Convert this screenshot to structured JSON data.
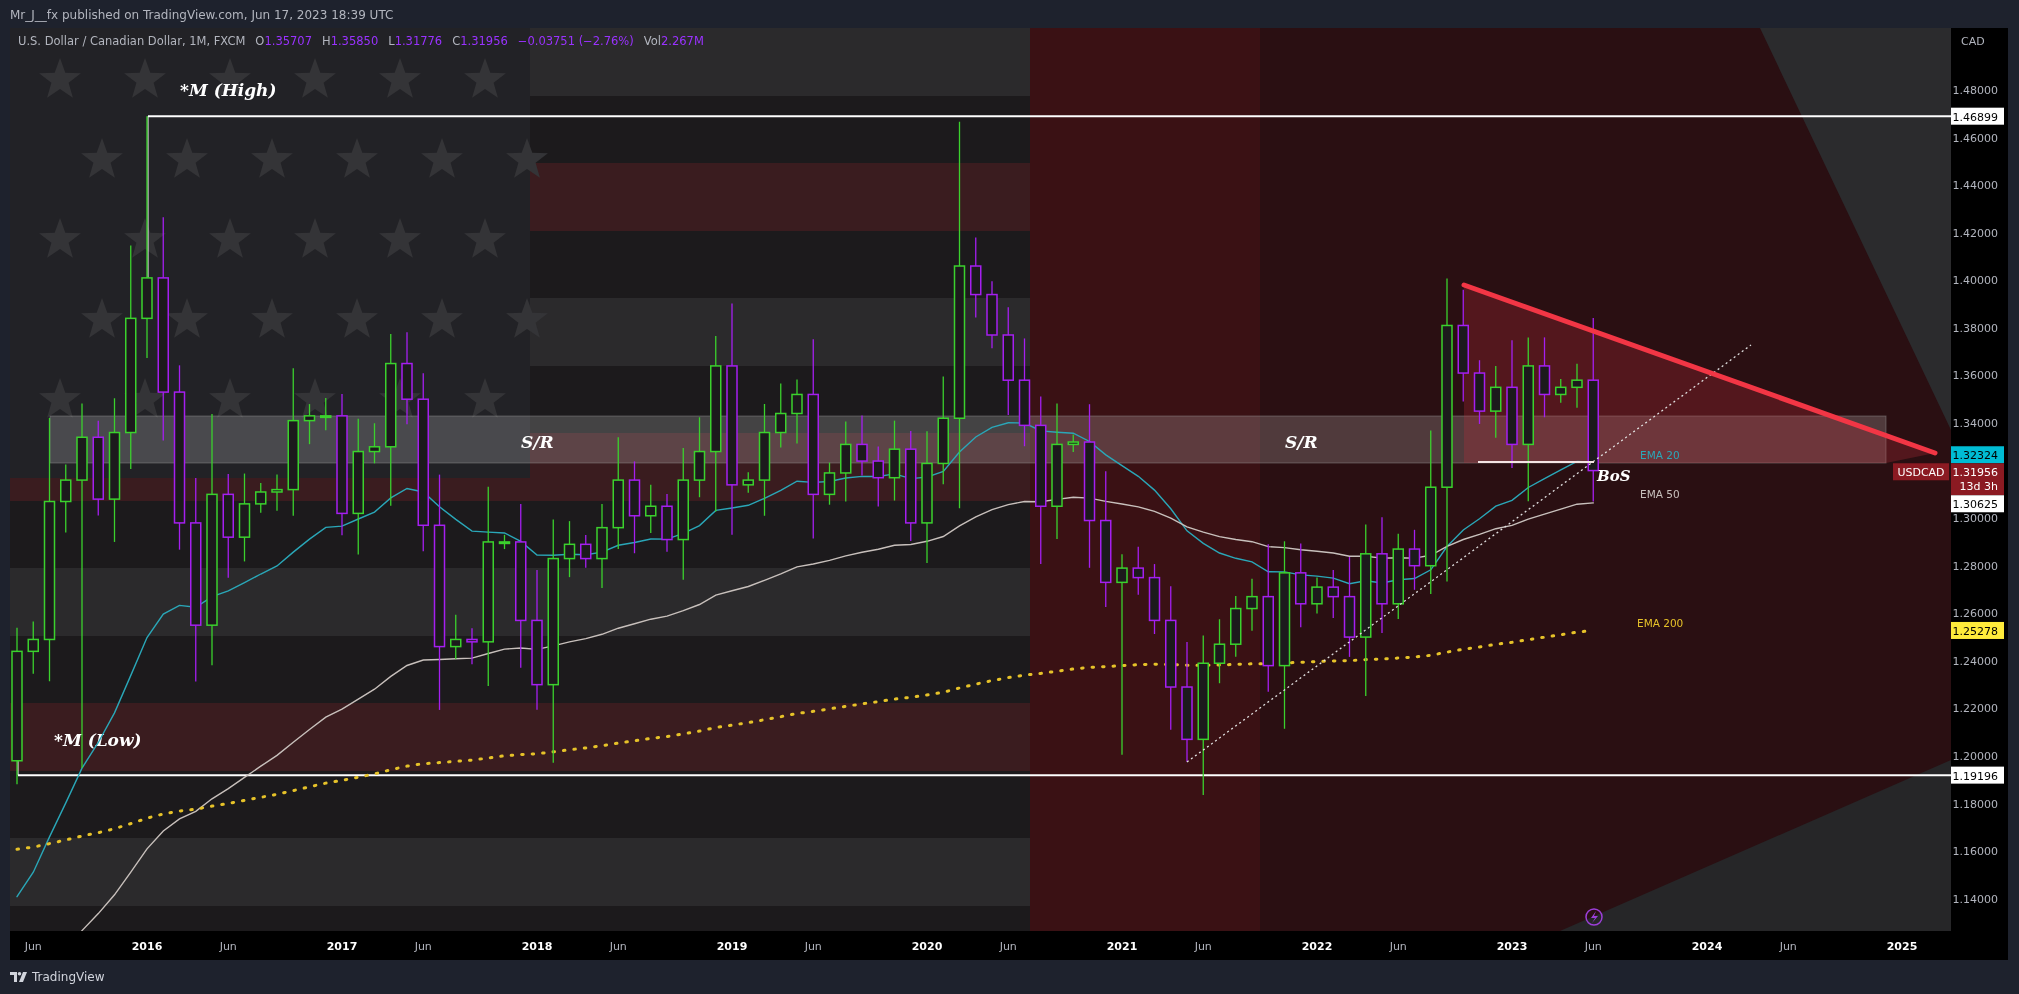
{
  "publisher_line": "Mr_J__fx published on TradingView.com, Jun 17, 2023 18:39 UTC",
  "legend": {
    "symbol": "U.S. Dollar / Canadian Dollar, 1M, FXCM",
    "values": [
      {
        "label": "O",
        "value": "1.35707"
      },
      {
        "label": "H",
        "value": "1.35850"
      },
      {
        "label": "L",
        "value": "1.31776"
      },
      {
        "label": "C",
        "value": "1.31956"
      }
    ],
    "change": "−0.03751 (−2.76%)",
    "volume": {
      "label": "Vol",
      "value": "2.267M"
    }
  },
  "annotations": {
    "high_label": "*M (High)",
    "low_label": "*M (Low)",
    "zone_labels": [
      "S/R",
      "S/R"
    ],
    "bos_label": "BoS"
  },
  "indicators": [
    {
      "name": "EMA 20",
      "color": "#2aa7b8"
    },
    {
      "name": "EMA 50",
      "color": "#c8c0bc"
    },
    {
      "name": "EMA 200",
      "color": "#e6c229"
    }
  ],
  "price_axis": {
    "currency": "CAD",
    "ticks": [
      "1.48000",
      "1.46000",
      "1.44000",
      "1.42000",
      "1.40000",
      "1.38000",
      "1.36000",
      "1.34000",
      "1.30000",
      "1.28000",
      "1.26000",
      "1.24000",
      "1.22000",
      "1.20000",
      "1.18000",
      "1.16000",
      "1.14000"
    ],
    "markers": [
      {
        "value": "1.46899",
        "color": "#ffffff"
      },
      {
        "value": "1.32324",
        "color": "#00bcd4"
      },
      {
        "value": "1.31956",
        "color": "#8b1a22",
        "symbol": "USDCAD",
        "countdown": "13d 3h"
      },
      {
        "value": "1.30625",
        "color": "#ffffff"
      },
      {
        "value": "1.25278",
        "color": "#ffeb3b"
      },
      {
        "value": "1.19196",
        "color": "#ffffff"
      }
    ]
  },
  "time_axis": [
    {
      "label": "Jun",
      "kind": "month"
    },
    {
      "label": "2016",
      "kind": "year"
    },
    {
      "label": "Jun",
      "kind": "month"
    },
    {
      "label": "2017",
      "kind": "year"
    },
    {
      "label": "Jun",
      "kind": "month"
    },
    {
      "label": "2018",
      "kind": "year"
    },
    {
      "label": "Jun",
      "kind": "month"
    },
    {
      "label": "2019",
      "kind": "year"
    },
    {
      "label": "Jun",
      "kind": "month"
    },
    {
      "label": "2020",
      "kind": "year"
    },
    {
      "label": "Jun",
      "kind": "month"
    },
    {
      "label": "2021",
      "kind": "year"
    },
    {
      "label": "Jun",
      "kind": "month"
    },
    {
      "label": "2022",
      "kind": "year"
    },
    {
      "label": "Jun",
      "kind": "month"
    },
    {
      "label": "2023",
      "kind": "year"
    },
    {
      "label": "Jun",
      "kind": "month"
    },
    {
      "label": "2024",
      "kind": "year"
    },
    {
      "label": "Jun",
      "kind": "month"
    },
    {
      "label": "2025",
      "kind": "year"
    }
  ],
  "footer": {
    "brand": "TradingView"
  }
}
